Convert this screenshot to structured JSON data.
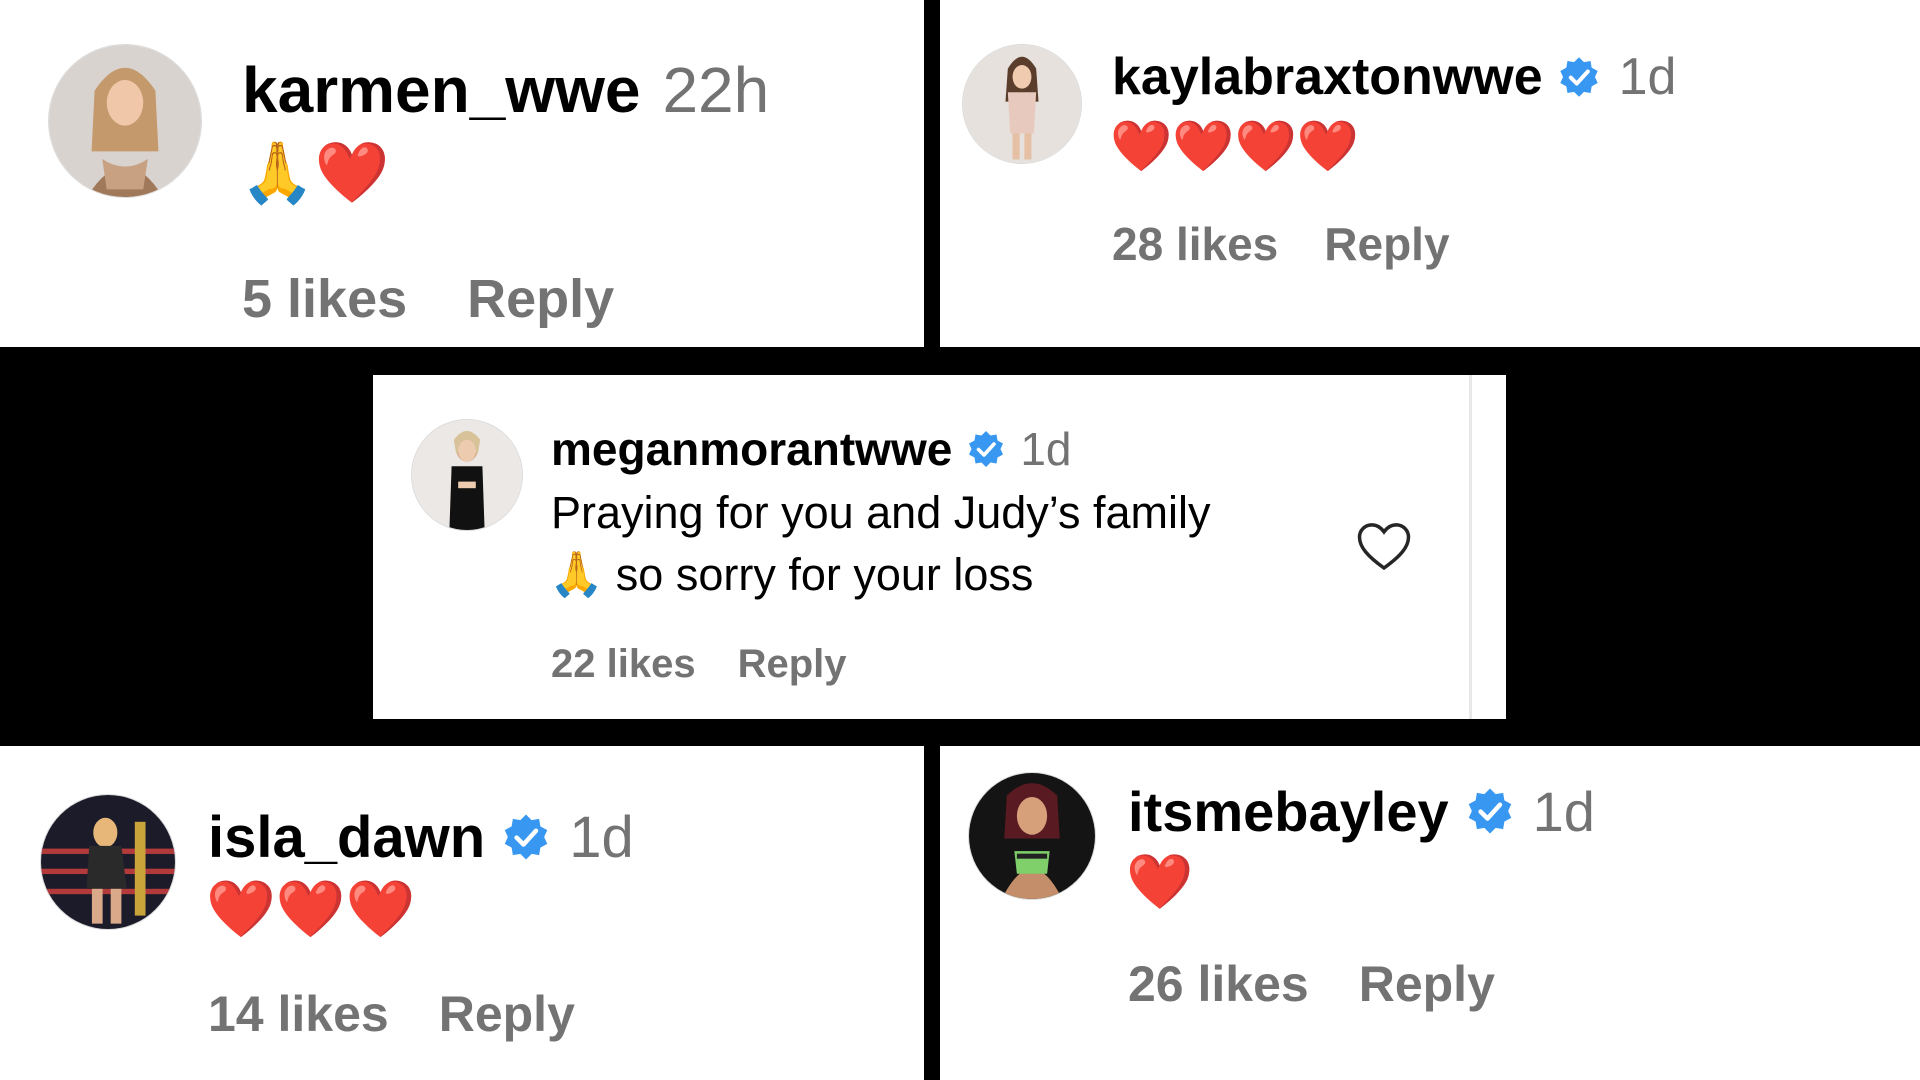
{
  "verified_color": "#3897f0",
  "comments": [
    {
      "username": "karmen_wwe",
      "time": "22h",
      "verified": false,
      "emoji": "🙏❤️",
      "text": "",
      "likes": "5 likes",
      "reply": "Reply"
    },
    {
      "username": "kaylabraxtonwwe",
      "time": "1d",
      "verified": true,
      "emoji": "❤️❤️❤️❤️",
      "text": "",
      "likes": "28 likes",
      "reply": "Reply"
    },
    {
      "username": "meganmorantwwe",
      "time": "1d",
      "verified": true,
      "emoji": "🙏",
      "text_line1": "Praying for you and Judy’s family",
      "text_line2": "so sorry for your loss",
      "likes": "22 likes",
      "reply": "Reply",
      "like_icon": "heart-outline-icon"
    },
    {
      "username": "isla_dawn",
      "time": "1d",
      "verified": true,
      "emoji": "❤️❤️❤️",
      "text": "",
      "likes": "14 likes",
      "reply": "Reply"
    },
    {
      "username": "itsmebayley",
      "time": "1d",
      "verified": true,
      "emoji": "❤️",
      "text": "",
      "likes": "26 likes",
      "reply": "Reply"
    }
  ]
}
